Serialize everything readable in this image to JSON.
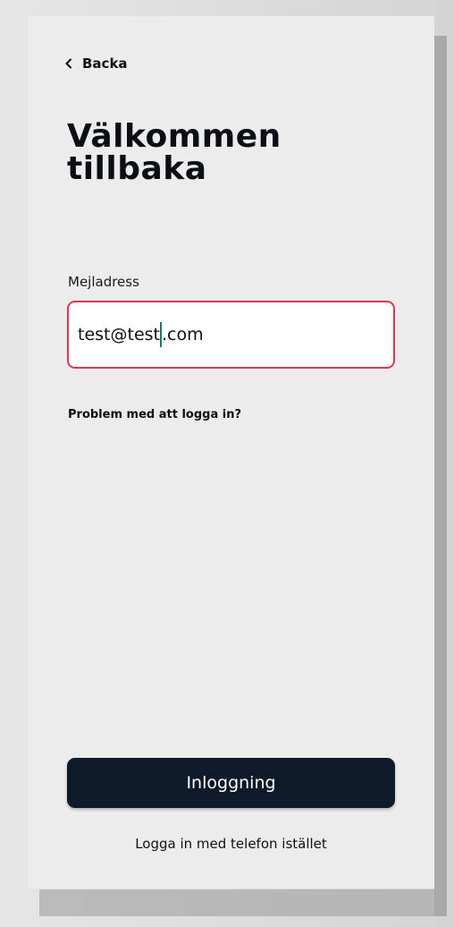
{
  "header": {
    "back_label": "Backa",
    "back_icon": "chevron-left-icon"
  },
  "title": "Välkommen tillbaka",
  "form": {
    "email_label": "Mejladress",
    "email_value_before_caret": "test@test",
    "email_value_after_caret": ".com",
    "email_value": "test@test.com",
    "email_border_color": "#e0354f",
    "caret_color": "#1e7a5a"
  },
  "help_link": "Problem med att logga in?",
  "login_button_label": "Inloggning",
  "login_button_color": "#0d1a29",
  "phone_login_link": "Logga in med telefon istället"
}
